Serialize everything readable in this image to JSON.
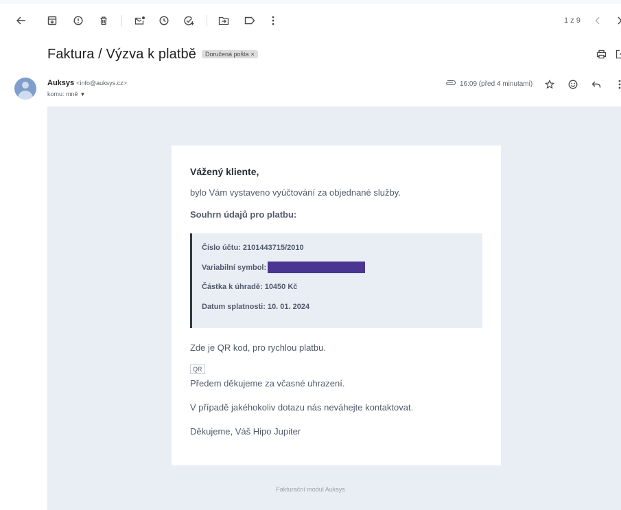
{
  "toolbar": {
    "icons": [
      "back-arrow-icon",
      "archive-icon",
      "report-spam-icon",
      "delete-icon",
      "mark-unread-icon",
      "snooze-icon",
      "add-task-icon",
      "move-to-icon",
      "label-icon",
      "more-vert-icon"
    ],
    "pager_text": "1 z 9"
  },
  "message": {
    "subject": "Faktura / Výzva k platbě",
    "label_chip": "Doručená pošta",
    "sender_name": "Auksys",
    "sender_email": "<info@auksys.cz>",
    "recipient": "komu: mně",
    "time": "16:09 (před 4 minutami)"
  },
  "email": {
    "greeting": "Vážený kliente,",
    "intro": "bylo Vám vystaveno vyúčtování za objednané služby.",
    "summary_title": "Souhrn údajů pro platbu:",
    "account_line": "Číslo účtu: 2101443715/2010",
    "variable_symbol_label": "Variabilní symbol:",
    "amount_line": "Částka k úhradě: 10450 Kč",
    "due_line": "Datum splatnosti: 10. 01. 2024",
    "qr_text": "Zde je QR kod, pro rychlou platbu.",
    "qr_alt": "QR",
    "thanks_advance": "Předem děkujeme za včasné uhrazení.",
    "contact_text": "V případě jakéhokoliv dotazu nás neváhejte kontaktovat.",
    "signoff": "Děkujeme, Váš Hipo Jupiter",
    "footer": "Fakturační modul Auksys"
  },
  "colors": {
    "redaction": "#4a3592",
    "email_background": "#e9eef5",
    "accent_bar": "#333843"
  }
}
